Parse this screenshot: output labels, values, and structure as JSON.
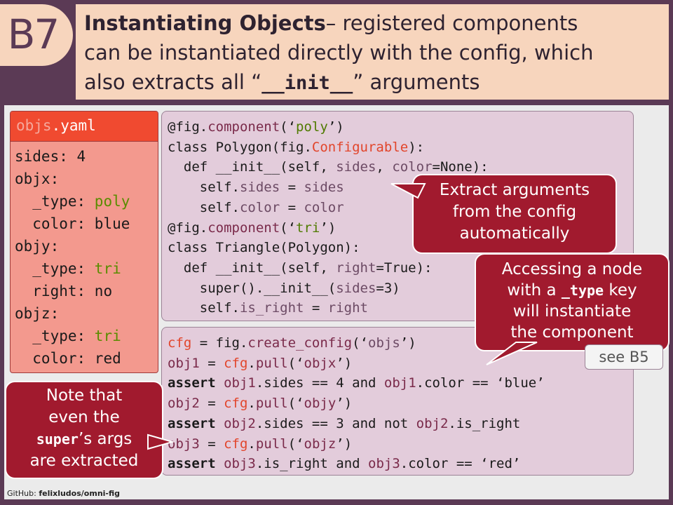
{
  "badge": "B7",
  "title": {
    "bold": "Instantiating Objects",
    "line1_rest": "– registered components",
    "line2": "can be instantiated directly with the config, which",
    "line3_pre": "also extracts all “",
    "line3_code": "__init__",
    "line3_post": "” arguments"
  },
  "yaml": {
    "filename_prefix": "objs",
    "filename_suffix": ".yaml",
    "lines": [
      {
        "key": "sides: ",
        "value": "4",
        "value_color": "default"
      },
      {
        "key": "objx:",
        "value": "",
        "value_color": "default"
      },
      {
        "key": "  _type: ",
        "value": "poly",
        "value_color": "green"
      },
      {
        "key": "  color: ",
        "value": "blue",
        "value_color": "default"
      },
      {
        "key": "objy:",
        "value": "",
        "value_color": "default"
      },
      {
        "key": "  _type: ",
        "value": "tri",
        "value_color": "green"
      },
      {
        "key": "  right: ",
        "value": "no",
        "value_color": "default"
      },
      {
        "key": "objz:",
        "value": "",
        "value_color": "default"
      },
      {
        "key": "  _type: ",
        "value": "tri",
        "value_color": "green"
      },
      {
        "key": "  color: ",
        "value": "red",
        "value_color": "default"
      }
    ]
  },
  "code_top": [
    [
      {
        "t": "@fig."
      },
      {
        "t": "component",
        "c": "fn"
      },
      {
        "t": "(‘"
      },
      {
        "t": "poly",
        "c": "str"
      },
      {
        "t": "’)"
      }
    ],
    [
      {
        "t": "class Polygon(fig."
      },
      {
        "t": "Configurable",
        "c": "red"
      },
      {
        "t": "):"
      }
    ],
    [
      {
        "t": "  def __init__(self, "
      },
      {
        "t": "sides",
        "c": "par"
      },
      {
        "t": ", "
      },
      {
        "t": "color",
        "c": "par"
      },
      {
        "t": "=None):"
      }
    ],
    [
      {
        "t": "    self."
      },
      {
        "t": "sides",
        "c": "par"
      },
      {
        "t": " = "
      },
      {
        "t": "sides",
        "c": "par"
      }
    ],
    [
      {
        "t": "    self."
      },
      {
        "t": "color",
        "c": "par"
      },
      {
        "t": " = "
      },
      {
        "t": "color",
        "c": "par"
      }
    ],
    [
      {
        "t": "@fig."
      },
      {
        "t": "component",
        "c": "fn"
      },
      {
        "t": "(‘"
      },
      {
        "t": "tri",
        "c": "str"
      },
      {
        "t": "’)"
      }
    ],
    [
      {
        "t": "class Triangle(Polygon):"
      }
    ],
    [
      {
        "t": "  def __init__(self, "
      },
      {
        "t": "right",
        "c": "par"
      },
      {
        "t": "=True):"
      }
    ],
    [
      {
        "t": "    super().__init__("
      },
      {
        "t": "sides",
        "c": "par"
      },
      {
        "t": "=3)"
      }
    ],
    [
      {
        "t": "    self."
      },
      {
        "t": "is_right",
        "c": "par"
      },
      {
        "t": " = "
      },
      {
        "t": "right",
        "c": "par"
      }
    ]
  ],
  "code_bottom": [
    [
      {
        "t": "cfg",
        "c": "red"
      },
      {
        "t": " = fig."
      },
      {
        "t": "create_config",
        "c": "fn"
      },
      {
        "t": "(‘"
      },
      {
        "t": "objs",
        "c": "par"
      },
      {
        "t": "’)"
      }
    ],
    [
      {
        "t": "obj1",
        "c": "fn"
      },
      {
        "t": " = "
      },
      {
        "t": "cfg",
        "c": "red"
      },
      {
        "t": "."
      },
      {
        "t": "pull",
        "c": "fn"
      },
      {
        "t": "(‘"
      },
      {
        "t": "objx",
        "c": "fn"
      },
      {
        "t": "’)"
      }
    ],
    [
      {
        "t": "assert",
        "c": "b"
      },
      {
        "t": " "
      },
      {
        "t": "obj1",
        "c": "fn"
      },
      {
        "t": ".sides == 4 and "
      },
      {
        "t": "obj1",
        "c": "fn"
      },
      {
        "t": ".color == ‘blue’"
      }
    ],
    [
      {
        "t": "obj2",
        "c": "fn"
      },
      {
        "t": " = "
      },
      {
        "t": "cfg",
        "c": "red"
      },
      {
        "t": "."
      },
      {
        "t": "pull",
        "c": "fn"
      },
      {
        "t": "(‘"
      },
      {
        "t": "objy",
        "c": "fn"
      },
      {
        "t": "’)"
      }
    ],
    [
      {
        "t": "assert",
        "c": "b"
      },
      {
        "t": " "
      },
      {
        "t": "obj2",
        "c": "fn"
      },
      {
        "t": ".sides == 3 and not "
      },
      {
        "t": "obj2",
        "c": "fn"
      },
      {
        "t": ".is_right"
      }
    ],
    [
      {
        "t": "obj3",
        "c": "fn"
      },
      {
        "t": " = "
      },
      {
        "t": "cfg",
        "c": "red"
      },
      {
        "t": "."
      },
      {
        "t": "pull",
        "c": "fn"
      },
      {
        "t": "(‘"
      },
      {
        "t": "objz",
        "c": "fn"
      },
      {
        "t": "’)"
      }
    ],
    [
      {
        "t": "assert",
        "c": "b"
      },
      {
        "t": " "
      },
      {
        "t": "obj3",
        "c": "fn"
      },
      {
        "t": ".is_right and "
      },
      {
        "t": "obj3",
        "c": "fn"
      },
      {
        "t": ".color == ‘red’"
      }
    ]
  ],
  "callouts": {
    "extract": [
      "Extract arguments",
      "from the config",
      "automatically"
    ],
    "access": {
      "line1": "Accessing a node",
      "line2_pre": "with a ",
      "line2_code": "_type",
      "line2_post": " key",
      "line3": "will instantiate",
      "line4": "the component"
    },
    "note": {
      "line1": "Note that",
      "line2": "even the",
      "line3_code": "super",
      "line3_post": "’s args",
      "line4": "are extracted"
    }
  },
  "see_ref": "see B5",
  "footer": {
    "label": "GitHub: ",
    "repo": "felixludos/omni-fig"
  },
  "colors": {
    "frame": "#5b3a55",
    "title_bg": "#f7d5bd",
    "yaml_header": "#f04a30",
    "yaml_bg": "#f3998e",
    "code_bg": "#e3ccdb",
    "callout_bg": "#a11a2e",
    "string_green": "#4f7a00"
  }
}
